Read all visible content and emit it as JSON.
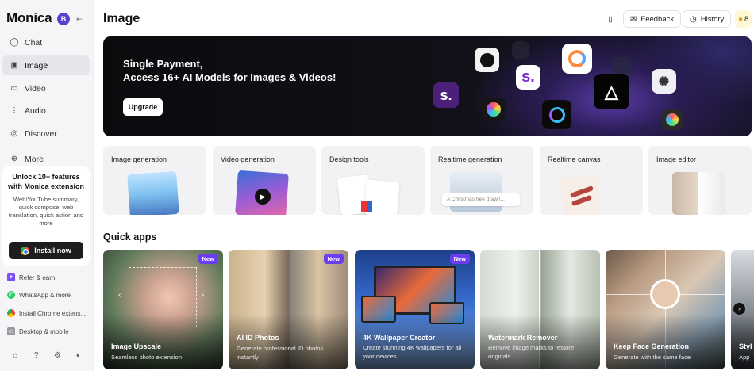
{
  "sidebar": {
    "brand": "Monica",
    "avatar_initial": "B",
    "nav": [
      {
        "label": "Chat",
        "icon": "chat-icon"
      },
      {
        "label": "Image",
        "icon": "image-icon",
        "active": true
      },
      {
        "label": "Video",
        "icon": "video-icon"
      },
      {
        "label": "Audio",
        "icon": "audio-icon"
      },
      {
        "label": "Discover",
        "icon": "compass-icon"
      },
      {
        "label": "More",
        "icon": "plus-icon"
      }
    ],
    "promo": {
      "title": "Unlock 10+ features with Monica extension",
      "desc": "Web/YouTube summary, quick compose, web translation, quick action and more",
      "button": "Install now"
    },
    "links": [
      {
        "label": "Refer & earn",
        "icon": "gift-icon",
        "color": "#7c4dff"
      },
      {
        "label": "WhatsApp & more",
        "icon": "whatsapp-icon",
        "color": "#25d366"
      },
      {
        "label": "Install Chrome extens...",
        "icon": "chrome-icon",
        "color": "#ea4335"
      },
      {
        "label": "Desktop & mobile",
        "icon": "desktop-icon",
        "color": "#888888"
      }
    ]
  },
  "header": {
    "title": "Image",
    "feedback": "Feedback",
    "history": "History",
    "credits": "8"
  },
  "banner": {
    "line1": "Single Payment,",
    "line2": "Access 16+ AI Models for Images & Videos!",
    "button": "Upgrade"
  },
  "tools": [
    {
      "label": "Image generation"
    },
    {
      "label": "Video generation"
    },
    {
      "label": "Design tools"
    },
    {
      "label": "Realtime generation",
      "prompt": "A Christmas tree drawn..."
    },
    {
      "label": "Realtime canvas"
    },
    {
      "label": "Image editor"
    }
  ],
  "quick_apps": {
    "title": "Quick apps",
    "badge": "New",
    "items": [
      {
        "title": "Image Upscale",
        "desc": "Seamless photo extension",
        "new": true
      },
      {
        "title": "AI ID Photos",
        "desc": "Generate professional ID photos instantly",
        "new": true
      },
      {
        "title": "4K Wallpaper Creator",
        "desc": "Create stunning 4K wallpapers for all your devices",
        "new": true
      },
      {
        "title": "Watermark Remover",
        "desc": "Remove image marks to restore originals",
        "new": false
      },
      {
        "title": "Keep Face Generation",
        "desc": "Generate with the same face",
        "new": false
      },
      {
        "title": "Styl",
        "desc": "App",
        "new": false
      }
    ]
  },
  "colors": {
    "accent": "#6d3ef0",
    "dark": "#1d1d1f"
  }
}
